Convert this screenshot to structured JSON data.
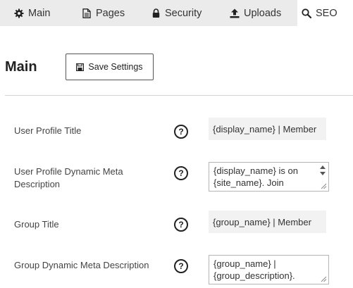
{
  "tabs": [
    {
      "label": "Main",
      "icon": "gear-icon",
      "active": false
    },
    {
      "label": "Pages",
      "icon": "document-icon",
      "active": false
    },
    {
      "label": "Security",
      "icon": "lock-icon",
      "active": false
    },
    {
      "label": "Uploads",
      "icon": "upload-icon",
      "active": false
    },
    {
      "label": "SEO",
      "icon": "search-icon",
      "active": true
    }
  ],
  "header": {
    "title": "Main",
    "save_label": "Save Settings",
    "save_icon": "save-icon"
  },
  "help_symbol": "?",
  "fields": [
    {
      "label": "User Profile Title",
      "type": "text",
      "value": "{display_name} | Member"
    },
    {
      "label": "User Profile Dynamic Meta Description",
      "type": "textarea",
      "lines": [
        "{display_name} is on",
        "{site_name}. Join"
      ]
    },
    {
      "label": "Group Title",
      "type": "text",
      "value": "{group_name} | Member"
    },
    {
      "label": "Group Dynamic Meta Description",
      "type": "textarea",
      "lines": [
        "{group_name} |",
        "{group_description}."
      ]
    }
  ],
  "colors": {
    "tabbar_bg": "#ebebeb",
    "field_bg": "#f2f2f2"
  }
}
